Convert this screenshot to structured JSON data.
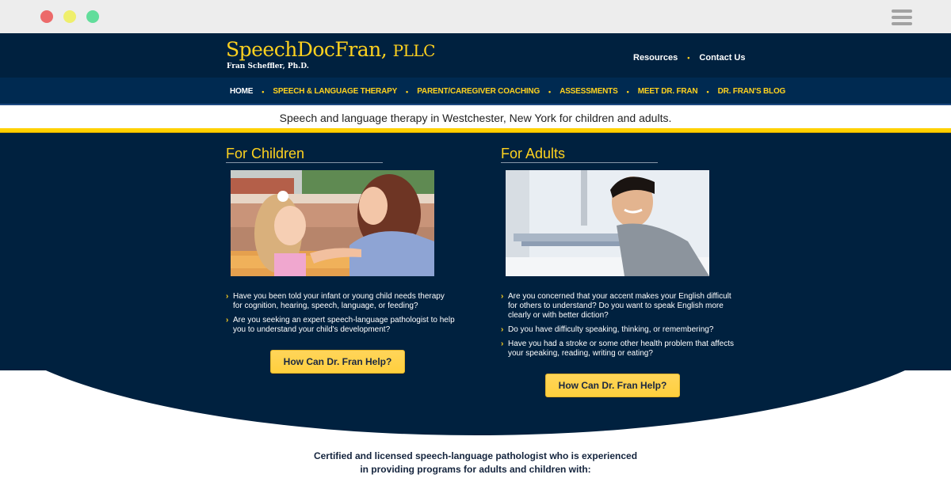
{
  "browser": {
    "window_controls": [
      "close",
      "minimize",
      "maximize"
    ],
    "menu_icon": "hamburger-menu-icon"
  },
  "header": {
    "logo_title": "SpeechDocFran,",
    "logo_suffix": "PLLC",
    "logo_subtitle": "Fran Scheffler, Ph.D.",
    "top_links": [
      {
        "label": "Resources"
      },
      {
        "label": "Contact Us"
      }
    ]
  },
  "nav": {
    "items": [
      {
        "label": "HOME",
        "active": true
      },
      {
        "label": "SPEECH & LANGUAGE THERAPY"
      },
      {
        "label": "PARENT/CAREGIVER COACHING"
      },
      {
        "label": "ASSESSMENTS"
      },
      {
        "label": "MEET DR. FRAN"
      },
      {
        "label": "DR. FRAN'S BLOG"
      }
    ],
    "separator": "•"
  },
  "tagline": "Speech and language therapy in Westchester, New York for children and adults.",
  "sections": {
    "children": {
      "title": "For Children",
      "image_alt": "Young girl and woman smiling at each other on a bench",
      "questions": [
        "Have you been told your infant or young child needs therapy for cognition, hearing, speech, language, or feeding?",
        "Are you seeking an expert speech-language pathologist to help you to understand your child's development?"
      ],
      "cta": "How Can Dr. Fran Help?"
    },
    "adults": {
      "title": "For Adults",
      "image_alt": "Smiling young man in gray shirt in bright office",
      "questions": [
        "Are you concerned that your accent makes your English difficult for others to understand? Do you want to speak English more clearly or with better diction?",
        "Do you have difficulty speaking, thinking, or remembering?",
        "Have you had a stroke or some other health problem that affects your speaking, reading, writing or eating?"
      ],
      "cta": "How Can Dr. Fran Help?"
    }
  },
  "certified": {
    "line1": "Certified and licensed speech-language pathologist who is experienced",
    "line2": "in providing programs for adults and children with:"
  },
  "colors": {
    "navy": "#00213f",
    "nav_blue": "#002a51",
    "gold": "#ffd21f",
    "button": "#ffd24a",
    "chrome": "#ededed"
  }
}
